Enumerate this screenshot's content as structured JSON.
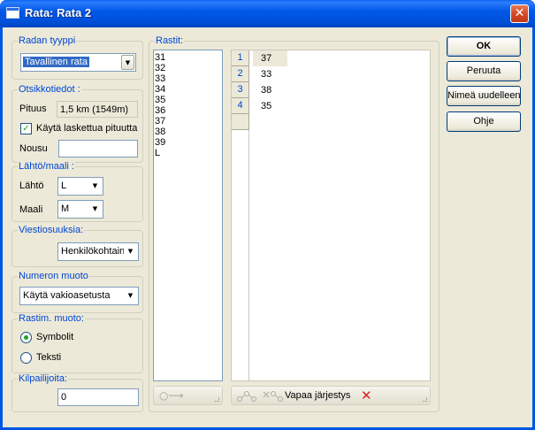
{
  "window": {
    "title": "Rata: Rata 2",
    "close_glyph": "✕"
  },
  "course_type": {
    "label": "Radan tyyppi",
    "value": "Tavallinen rata"
  },
  "header_info": {
    "label": "Otsikkotiedot :",
    "length_label": "Pituus",
    "length_value": "1,5 km (1549m)",
    "use_calculated_label": "Käytä laskettua pituutta",
    "use_calculated_checked": true,
    "climb_label": "Nousu",
    "climb_value": ""
  },
  "start_finish": {
    "label": "Lähtö/maali :",
    "start_label": "Lähtö",
    "start_value": "L",
    "finish_label": "Maali",
    "finish_value": "M"
  },
  "relay_legs": {
    "label": "Viestiosuuksia:",
    "value": "Henkilökohtain"
  },
  "number_format": {
    "label": "Numeron muoto",
    "value": "Käytä vakioasetusta"
  },
  "control_format": {
    "label": "Rastim. muoto:",
    "options": [
      {
        "label": "Symbolit",
        "selected": true
      },
      {
        "label": "Teksti",
        "selected": false
      }
    ]
  },
  "competitors": {
    "label": "Kilpailijoita:",
    "value": "0"
  },
  "controls": {
    "label": "Rastit:",
    "available": [
      "31",
      "32",
      "33",
      "34",
      "35",
      "36",
      "37",
      "38",
      "39",
      "L"
    ],
    "course_rows": [
      {
        "num": "1",
        "code": "37"
      },
      {
        "num": "2",
        "code": "33"
      },
      {
        "num": "3",
        "code": "38"
      },
      {
        "num": "4",
        "code": "35"
      }
    ],
    "free_order_label": "Vapaa järjestys",
    "delete_icon": "✕",
    "arrow_glyph": "○⟶"
  },
  "buttons": {
    "ok": "OK",
    "cancel": "Peruuta",
    "rename": "Nimeä uudelleen",
    "help": "Ohje"
  },
  "colors": {
    "title_bar": "#0055e5",
    "group_label": "#0046d5",
    "delete_red": "#e02020",
    "check_green": "#21a121"
  }
}
